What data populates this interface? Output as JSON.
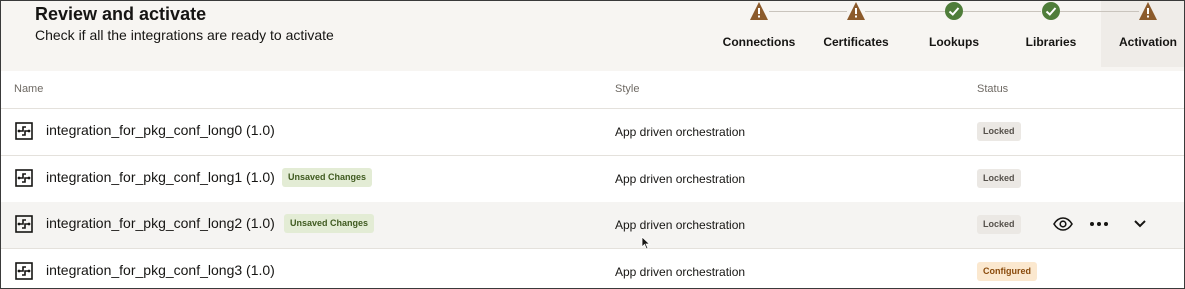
{
  "header": {
    "title": "Review and activate",
    "subtitle": "Check if all the integrations are ready to activate"
  },
  "train": [
    {
      "label": "Connections",
      "state": "warning",
      "icon": "warning-icon"
    },
    {
      "label": "Certificates",
      "state": "warning",
      "icon": "warning-icon"
    },
    {
      "label": "Lookups",
      "state": "complete",
      "icon": "check-icon"
    },
    {
      "label": "Libraries",
      "state": "complete",
      "icon": "check-icon"
    },
    {
      "label": "Activation",
      "state": "warning",
      "icon": "warning-icon",
      "active": true
    }
  ],
  "table": {
    "columns": {
      "name": "Name",
      "style": "Style",
      "status": "Status"
    },
    "rows": [
      {
        "name": "integration_for_pkg_conf_long0 (1.0)",
        "badge": "",
        "style": "App driven orchestration",
        "status": "Locked"
      },
      {
        "name": "integration_for_pkg_conf_long1 (1.0)",
        "badge": "Unsaved Changes",
        "style": "App driven orchestration",
        "status": "Locked"
      },
      {
        "name": "integration_for_pkg_conf_long2 (1.0)",
        "badge": "Unsaved Changes",
        "style": "App driven orchestration",
        "status": "Locked"
      },
      {
        "name": "integration_for_pkg_conf_long3 (1.0)",
        "badge": "",
        "style": "App driven orchestration",
        "status": "Configured"
      }
    ]
  },
  "row_actions": {
    "view_icon": "eye-icon",
    "more_icon": "more-icon",
    "expand_icon": "chevron-down-icon"
  },
  "colors": {
    "warning": "#8b5a2b",
    "complete": "#4f7d3a",
    "header_bg": "#f7f5f2",
    "unsaved_bg": "#e3ecd5",
    "configured_bg": "#fbe8cf"
  }
}
